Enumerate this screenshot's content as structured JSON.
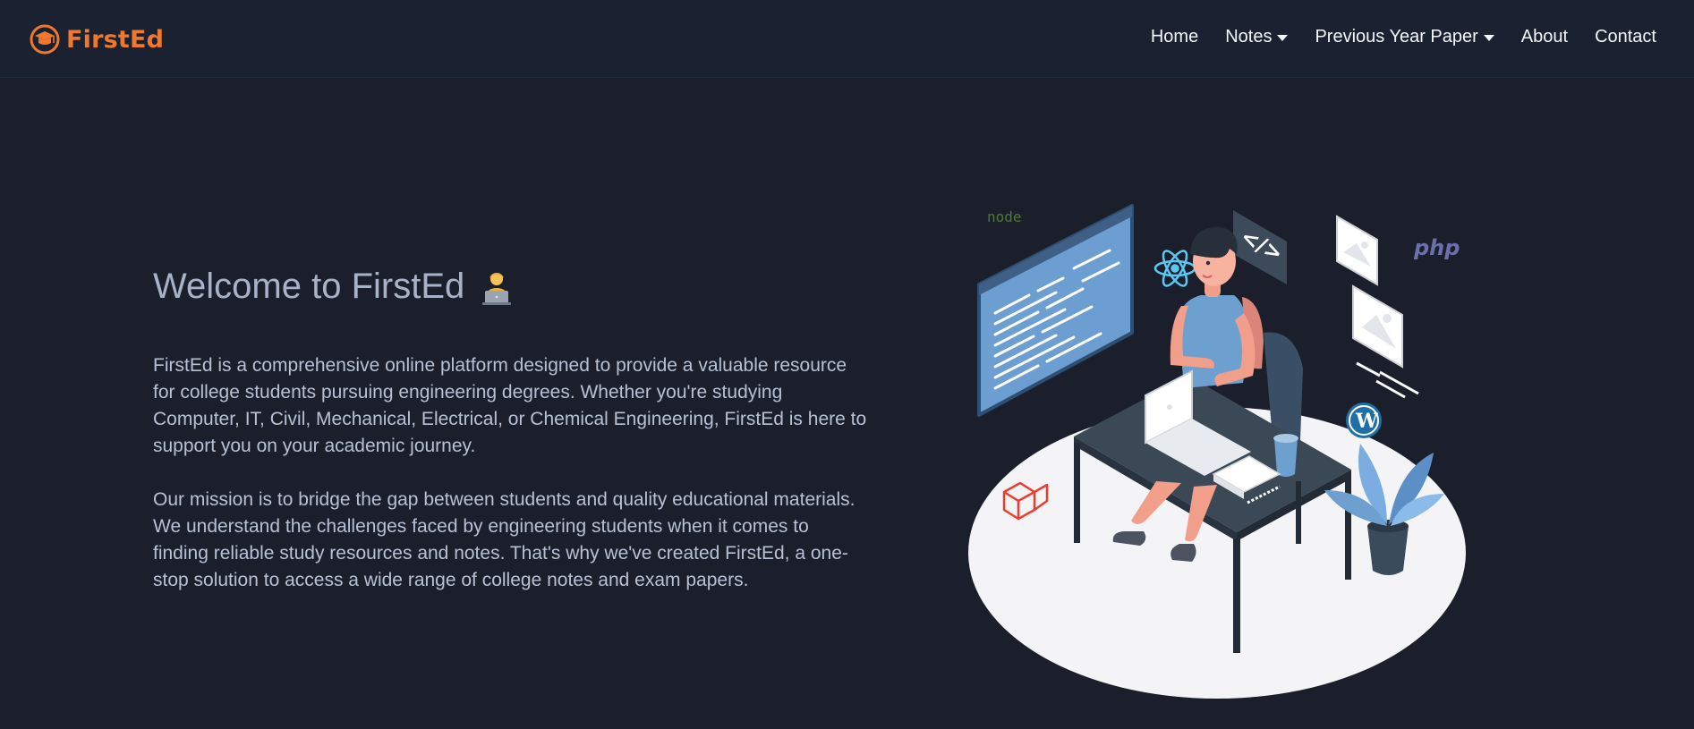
{
  "brand": {
    "name": "FirstEd",
    "icon": "graduation-cap-globe-icon",
    "color": "#f0782c"
  },
  "nav": {
    "items": [
      {
        "label": "Home",
        "dropdown": false
      },
      {
        "label": "Notes",
        "dropdown": true
      },
      {
        "label": "Previous Year Paper",
        "dropdown": true
      },
      {
        "label": "About",
        "dropdown": false
      },
      {
        "label": "Contact",
        "dropdown": false
      }
    ]
  },
  "hero": {
    "title": "Welcome to FirstEd",
    "title_icon": "person-at-laptop-emoji",
    "paragraph_1": "FirstEd is a comprehensive online platform designed to provide a valuable resource for college students pursuing engineering degrees. Whether you're studying Computer, IT, Civil, Mechanical, Electrical, or Chemical Engineering, FirstEd is here to support you on your academic journey.",
    "paragraph_2": "Our mission is to bridge the gap between students and quality educational materials. We understand the challenges faced by engineering students when it comes to finding reliable study resources and notes. That's why we've created FirstEd, a one-stop solution to access a wide range of college notes and exam papers."
  },
  "illustration": {
    "labels": {
      "node": "node",
      "php": "php"
    },
    "code_symbol": "</>"
  },
  "colors": {
    "background": "#1b1f2b",
    "navbar": "#1a2231",
    "accent": "#f0782c",
    "text_light": "#b7c1d6"
  }
}
